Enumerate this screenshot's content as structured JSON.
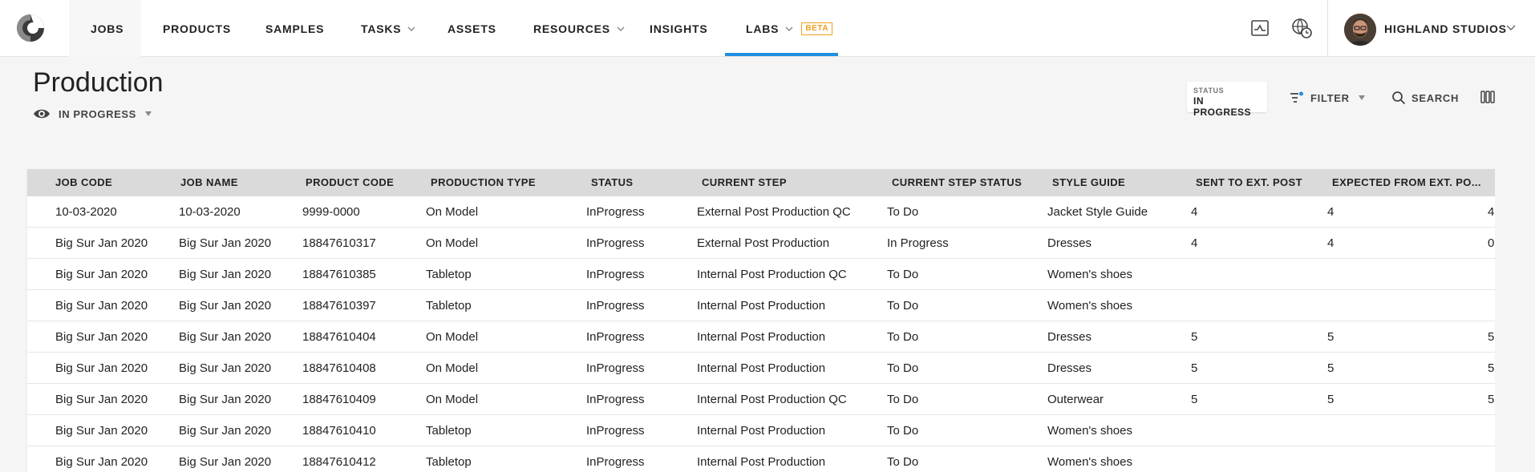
{
  "nav": {
    "items": [
      {
        "label": "JOBS",
        "has_dropdown": false
      },
      {
        "label": "PRODUCTS",
        "has_dropdown": false
      },
      {
        "label": "SAMPLES",
        "has_dropdown": false
      },
      {
        "label": "TASKS",
        "has_dropdown": true
      },
      {
        "label": "ASSETS",
        "has_dropdown": false
      },
      {
        "label": "RESOURCES",
        "has_dropdown": true
      },
      {
        "label": "INSIGHTS",
        "has_dropdown": false
      },
      {
        "label": "LABS",
        "has_dropdown": true,
        "badge": "BETA"
      }
    ],
    "active_item": "LABS",
    "hover_item": "JOBS",
    "account": "HIGHLAND STUDIOS",
    "icons": [
      "activity-chart-icon",
      "globe-clock-icon"
    ],
    "accent_color": "#1f8fe0"
  },
  "page": {
    "title": "Production",
    "view": "IN PROGRESS"
  },
  "toolbar": {
    "status_key": "STATUS",
    "status_value": "IN PROGRESS",
    "filter_label": "FILTER",
    "search_label": "SEARCH"
  },
  "table": {
    "columns": [
      "JOB CODE",
      "JOB NAME",
      "PRODUCT CODE",
      "PRODUCTION TYPE",
      "STATUS",
      "CURRENT STEP",
      "CURRENT STEP STATUS",
      "STYLE GUIDE",
      "SENT TO EXT. POST",
      "EXPECTED FROM EXT. PO...",
      ""
    ],
    "rows": [
      [
        "10-03-2020",
        "10-03-2020",
        "9999-0000",
        "On Model",
        "InProgress",
        "External Post Production QC",
        "To Do",
        "Jacket Style Guide",
        "4",
        "4",
        "4"
      ],
      [
        "Big Sur Jan 2020",
        "Big Sur Jan 2020",
        "18847610317",
        "On Model",
        "InProgress",
        "External Post Production",
        "In Progress",
        "Dresses",
        "4",
        "4",
        "0"
      ],
      [
        "Big Sur Jan 2020",
        "Big Sur Jan 2020",
        "18847610385",
        "Tabletop",
        "InProgress",
        "Internal Post Production QC",
        "To Do",
        "Women's shoes",
        "",
        "",
        ""
      ],
      [
        "Big Sur Jan 2020",
        "Big Sur Jan 2020",
        "18847610397",
        "Tabletop",
        "InProgress",
        "Internal Post Production",
        "To Do",
        "Women's shoes",
        "",
        "",
        ""
      ],
      [
        "Big Sur Jan 2020",
        "Big Sur Jan 2020",
        "18847610404",
        "On Model",
        "InProgress",
        "Internal Post Production",
        "To Do",
        "Dresses",
        "5",
        "5",
        "5"
      ],
      [
        "Big Sur Jan 2020",
        "Big Sur Jan 2020",
        "18847610408",
        "On Model",
        "InProgress",
        "Internal Post Production",
        "To Do",
        "Dresses",
        "5",
        "5",
        "5"
      ],
      [
        "Big Sur Jan 2020",
        "Big Sur Jan 2020",
        "18847610409",
        "On Model",
        "InProgress",
        "Internal Post Production QC",
        "To Do",
        "Outerwear",
        "5",
        "5",
        "5"
      ],
      [
        "Big Sur Jan 2020",
        "Big Sur Jan 2020",
        "18847610410",
        "Tabletop",
        "InProgress",
        "Internal Post Production",
        "To Do",
        "Women's shoes",
        "",
        "",
        ""
      ],
      [
        "Big Sur Jan 2020",
        "Big Sur Jan 2020",
        "18847610412",
        "Tabletop",
        "InProgress",
        "Internal Post Production",
        "To Do",
        "Women's shoes",
        "",
        "",
        ""
      ]
    ]
  }
}
